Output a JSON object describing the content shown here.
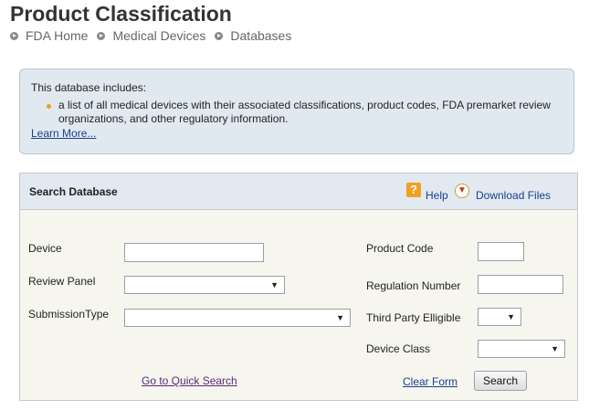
{
  "page": {
    "title": "Product Classification"
  },
  "breadcrumb": [
    "FDA Home",
    "Medical Devices",
    "Databases"
  ],
  "info": {
    "intro": "This database includes:",
    "items": [
      "a list of all medical devices with their associated classifications, product codes, FDA premarket review organizations, and other regulatory information."
    ],
    "learn_more": "Learn More..."
  },
  "search": {
    "title": "Search Database",
    "help_label": "Help",
    "help_icon": "?",
    "download_label": "Download Files",
    "fields": {
      "device": {
        "label": "Device",
        "value": ""
      },
      "review_panel": {
        "label": "Review Panel",
        "selected": ""
      },
      "submission_type": {
        "label": "SubmissionType",
        "selected": ""
      },
      "product_code": {
        "label": "Product Code",
        "value": ""
      },
      "regulation_number": {
        "label": "Regulation Number",
        "value": ""
      },
      "third_party": {
        "label": "Third Party Elligible",
        "selected": ""
      },
      "device_class": {
        "label": "Device Class",
        "selected": ""
      }
    },
    "quick_search_link": "Go to Quick Search",
    "clear_form": "Clear Form",
    "search_button": "Search"
  },
  "colors": {
    "link": "#1a3f8c",
    "visited_link": "#5a2a7a",
    "panel_bg": "#f6f6ee",
    "header_bg": "#e2e9f1",
    "info_bg": "#e1e9f0"
  }
}
